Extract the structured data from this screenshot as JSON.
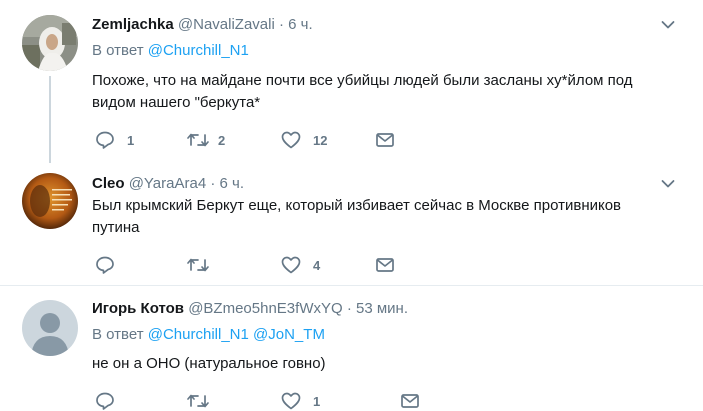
{
  "tweets": [
    {
      "name": "Zemljachka",
      "handle": "@NavaliZavali",
      "time": "6 ч.",
      "reply_prefix": "В ответ",
      "reply_mentions": [
        "@Churchill_N1"
      ],
      "text_lines": [
        "Похоже, что на майдане почти все убийцы людей были засланы ху*йлом под",
        "видом нашего \"беркута*"
      ],
      "counts": {
        "reply": "1",
        "retweet": "2",
        "like": "12"
      },
      "avatar_icon": "woman-in-headscarf-photo"
    },
    {
      "name": "Cleo",
      "handle": "@YaraAra4",
      "time": "6 ч.",
      "text_lines": [
        "Был крымский Беркут еще, который избивает сейчас в Москве противников",
        "путина"
      ],
      "counts": {
        "reply": "",
        "retweet": "",
        "like": "4"
      },
      "avatar_icon": "orange-face-with-text-photo"
    },
    {
      "name": "Игорь Котов",
      "handle": "@BZmeo5hnE3fWxYQ",
      "time": "53 мин.",
      "reply_prefix": "В ответ",
      "reply_mentions": [
        "@Churchill_N1",
        "@JoN_TM"
      ],
      "text_lines": [
        "не он а ОНО (натуральное говно)"
      ],
      "counts": {
        "reply": "",
        "retweet": "",
        "like": "1"
      },
      "avatar_icon": "default-profile-icon"
    }
  ],
  "separator": "·",
  "colors": {
    "accent": "#1da1f2",
    "muted": "#657786",
    "text": "#14171a",
    "line": "#ccd6dd"
  }
}
